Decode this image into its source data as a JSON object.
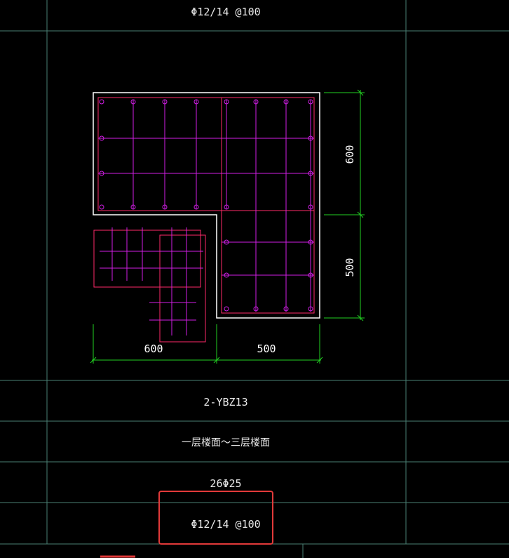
{
  "drawing": {
    "top_stirrup_label": "Φ12/14 @100",
    "section_name": "2-YBZ13",
    "floor_range": "一层楼面～三层楼面",
    "longitudinal_rebar": "26Φ25",
    "stirrup_spec": "Φ12/14 @100"
  },
  "dimensions": {
    "bottom_left": "600",
    "bottom_right": "500",
    "right_top": "600",
    "right_bottom": "500"
  },
  "colors": {
    "background": "#000000",
    "grid_line": "#4a7f73",
    "outline": "#ffffff",
    "stirrup": "#ff2a6a",
    "rebar_tie": "#d21ee6",
    "dimension": "#22d022",
    "highlight_box": "#e23a3a"
  }
}
